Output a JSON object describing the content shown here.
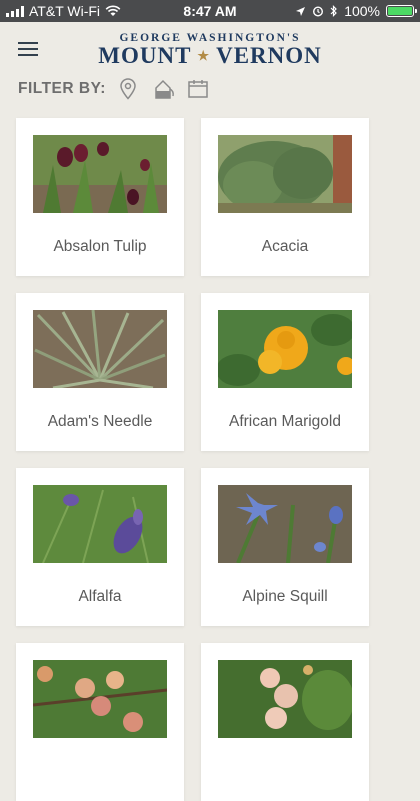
{
  "status_bar": {
    "carrier": "AT&T Wi-Fi",
    "time": "8:47 AM",
    "battery": "100%",
    "battery_level": 1.0
  },
  "header": {
    "logo_top": "GEORGE WASHINGTON'S",
    "logo_main_left": "MOUNT",
    "logo_main_right": "VERNON"
  },
  "filter": {
    "label": "FILTER BY:",
    "icons": [
      "location-pin-icon",
      "watering-can-icon",
      "calendar-icon"
    ]
  },
  "plants": [
    {
      "name": "Absalon Tulip",
      "image": "tulip-photo"
    },
    {
      "name": "Acacia",
      "image": "shrub-photo"
    },
    {
      "name": "Adam's Needle",
      "image": "yucca-photo"
    },
    {
      "name": "African Marigold",
      "image": "marigold-photo"
    },
    {
      "name": "Alfalfa",
      "image": "alfalfa-photo"
    },
    {
      "name": "Alpine Squill",
      "image": "squill-photo"
    },
    {
      "name": "",
      "image": "fruit-tree-photo"
    },
    {
      "name": "",
      "image": "fruit-photo"
    }
  ],
  "colors": {
    "background": "#edebe5",
    "logo_navy": "#1f3a5f",
    "logo_gold": "#b28b45",
    "status_bar": "#4a4b4d",
    "battery_green": "#4cd964"
  }
}
